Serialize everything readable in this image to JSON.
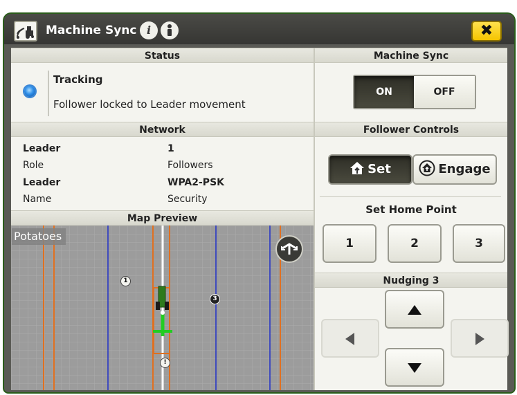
{
  "window": {
    "title": "Machine Sync",
    "close_label": "✖"
  },
  "status": {
    "header": "Status",
    "state": "Tracking",
    "message": "Follower locked to Leader movement",
    "indicator_color": "#2e8ee8"
  },
  "machine_sync": {
    "header": "Machine Sync",
    "on_label": "ON",
    "off_label": "OFF",
    "selected": "ON"
  },
  "network": {
    "header": "Network",
    "rows": [
      {
        "label_top": "Leader",
        "label_bottom": "Role",
        "value_top": "1",
        "value_bottom": "Followers"
      },
      {
        "label_top": "Leader",
        "label_bottom": "Name",
        "value_top": "WPA2-PSK",
        "value_bottom": "Security"
      }
    ]
  },
  "follower_controls": {
    "header": "Follower Controls",
    "set_label": "Set",
    "engage_label": "Engage",
    "home_point_title": "Set Home Point",
    "home_points": [
      "1",
      "2",
      "3"
    ],
    "nudging_title": "Nudging 3"
  },
  "map_preview": {
    "header": "Map Preview",
    "field_name": "Potatoes",
    "markers": [
      "1",
      "3",
      "!"
    ]
  },
  "colors": {
    "accent_yellow": "#f5c400",
    "field_line_blue": "#2030c8",
    "field_line_orange": "#e07020",
    "guidance_green": "#22cc22"
  }
}
